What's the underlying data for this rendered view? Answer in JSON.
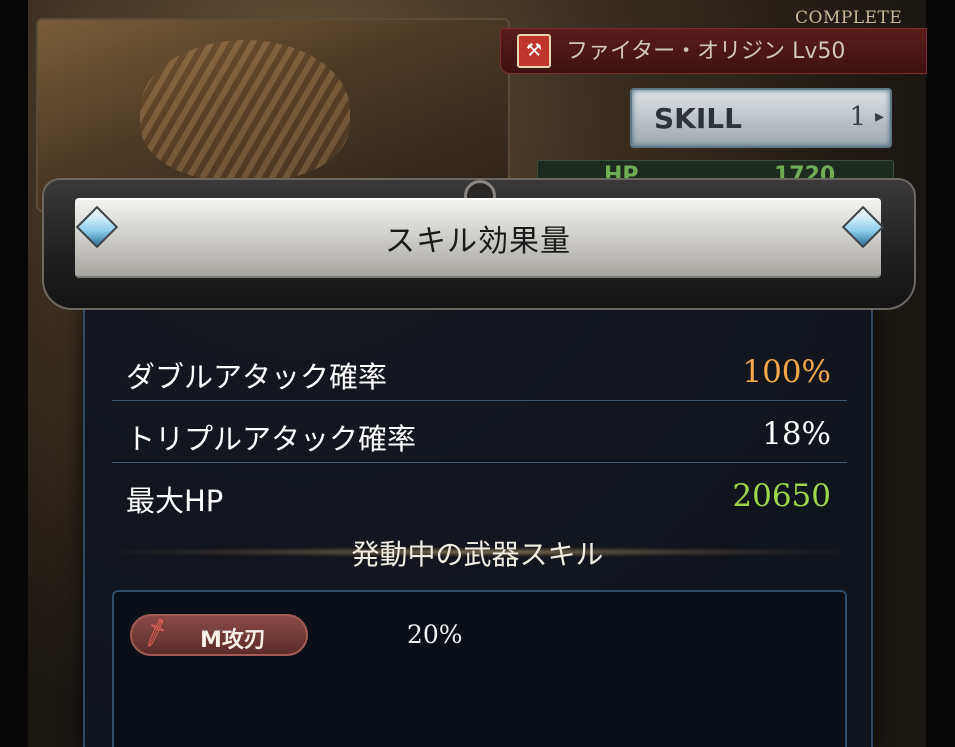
{
  "background": {
    "complete_tag": "COMPLETE",
    "class_name": "ファイター・オリジン Lv50",
    "skill_button": {
      "label": "SKILL",
      "count": "1"
    },
    "hp_label": "HP",
    "hp_value": "1720"
  },
  "popup": {
    "title": "スキル効果量",
    "stats": [
      {
        "label": "ダブルアタック確率",
        "value": "100%",
        "color": "#f4a64a"
      },
      {
        "label": "トリプルアタック確率",
        "value": "18%",
        "color": "#ffffff"
      },
      {
        "label": "最大HP",
        "value": "20650",
        "color": "#9ed64a"
      }
    ],
    "weapon_section_title": "発動中の武器スキル",
    "weapon_skills": [
      {
        "icon": "sword-icon",
        "name": "M攻刃",
        "value": "20%"
      }
    ]
  }
}
